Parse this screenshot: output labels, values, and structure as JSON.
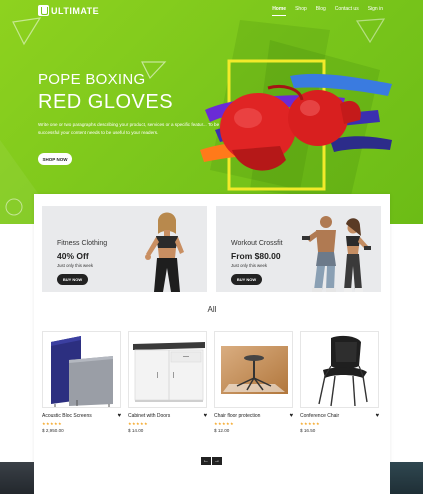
{
  "brand": {
    "logo_text": "ULTIMATE"
  },
  "nav": {
    "items": [
      {
        "label": "Home",
        "active": true
      },
      {
        "label": "Shop",
        "active": false
      },
      {
        "label": "Blog",
        "active": false
      },
      {
        "label": "Contact us",
        "active": false
      },
      {
        "label": "Sign in",
        "active": false
      }
    ]
  },
  "hero": {
    "subtitle": "POPE BOXING",
    "title": "RED GLOVES",
    "description": "Write one or two paragraphs describing your product, services or a specific featur... To be successful your content needs to be useful to your readers.",
    "button": "SHOP NOW",
    "colors": {
      "background": "#7cc71c",
      "accent": "#f2ea2a",
      "glove": "#e02424"
    }
  },
  "promos": [
    {
      "kicker": "Fitness Clothing",
      "price": "40% Off",
      "note": "Just only this week",
      "button": "BUY NOW"
    },
    {
      "kicker": "Workout Crossfit",
      "price": "From $80.00",
      "note": "Just only this week",
      "button": "BUY NOW"
    }
  ],
  "section": {
    "label": "All"
  },
  "products": [
    {
      "name": "Acoustic Bloc Screens",
      "rating": "★★★★★",
      "price": "$ 2,950.00"
    },
    {
      "name": "Cabinet with Doors",
      "rating": "★★★★★",
      "price": "$ 14.00"
    },
    {
      "name": "Chair floor protection",
      "rating": "★★★★★",
      "price": "$ 12.00"
    },
    {
      "name": "Conference Chair",
      "rating": "★★★★★",
      "price": "$ 16.50"
    }
  ],
  "pager": {
    "prev": "←",
    "next": "→"
  },
  "icons": {
    "wishlist": "heart-icon",
    "prev": "arrow-left-icon",
    "next": "arrow-right-icon"
  }
}
